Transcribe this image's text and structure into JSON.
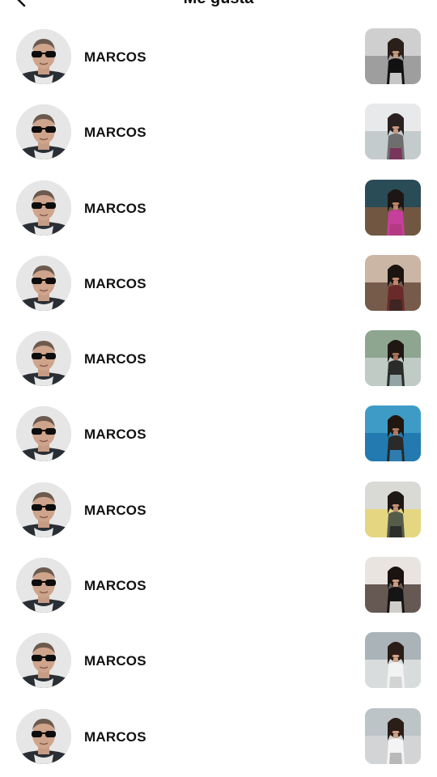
{
  "header": {
    "title": "Me gusta",
    "back_icon": "chevron-left-icon"
  },
  "likes": [
    {
      "name": "MARCOS",
      "thumb": {
        "bg1": "#cfcfcf",
        "bg2": "#8e8e8e",
        "hair": "#2b1f1a",
        "skin": "#c79a7c",
        "top": "#111111",
        "bottom": "#dcdcdc"
      }
    },
    {
      "name": "MARCOS",
      "thumb": {
        "bg1": "#e7e9ea",
        "bg2": "#b8c0c3",
        "hair": "#2a2020",
        "skin": "#c89a7f",
        "top": "#6e6e6e",
        "bottom": "#7a2f5a"
      }
    },
    {
      "name": "MARCOS",
      "thumb": {
        "bg1": "#2a4c57",
        "bg2": "#8a5b3a",
        "hair": "#1d1614",
        "skin": "#b98569",
        "top": "#c63f9b",
        "bottom": "#b0397f"
      }
    },
    {
      "name": "MARCOS",
      "thumb": {
        "bg1": "#cbb6a6",
        "bg2": "#5a3b2b",
        "hair": "#1b1411",
        "skin": "#c0876c",
        "top": "#6b2a2a",
        "bottom": "#3a2520"
      }
    },
    {
      "name": "MARCOS",
      "thumb": {
        "bg1": "#8ea58f",
        "bg2": "#cfd8d6",
        "hair": "#1e1714",
        "skin": "#a8735a",
        "top": "#2b2b2b",
        "bottom": "#9fb1b3"
      }
    },
    {
      "name": "MARCOS",
      "thumb": {
        "bg1": "#3d9bc6",
        "bg2": "#1a6fa8",
        "hair": "#201711",
        "skin": "#b07a5f",
        "top": "#2a2a2a",
        "bottom": "#2f86c0"
      }
    },
    {
      "name": "MARCOS",
      "thumb": {
        "bg1": "#d9d9d5",
        "bg2": "#e8d466",
        "hair": "#1f1713",
        "skin": "#c48f73",
        "top": "#565c4a",
        "bottom": "#2a2a2a"
      }
    },
    {
      "name": "MARCOS",
      "thumb": {
        "bg1": "#e9e4e0",
        "bg2": "#3a2b26",
        "hair": "#1a1310",
        "skin": "#cf9c82",
        "top": "#151515",
        "bottom": "#e6e1dc"
      }
    },
    {
      "name": "MARCOS",
      "thumb": {
        "bg1": "#a9b3b8",
        "bg2": "#eaeaea",
        "hair": "#2a1c16",
        "skin": "#cfa186",
        "top": "#f2f2f2",
        "bottom": "#cfcfcf"
      }
    },
    {
      "name": "MARCOS",
      "thumb": {
        "bg1": "#bcc4c8",
        "bg2": "#d9d9d9",
        "hair": "#2b1d17",
        "skin": "#d0a187",
        "top": "#f4f4f4",
        "bottom": "#b3b3b3"
      }
    }
  ]
}
